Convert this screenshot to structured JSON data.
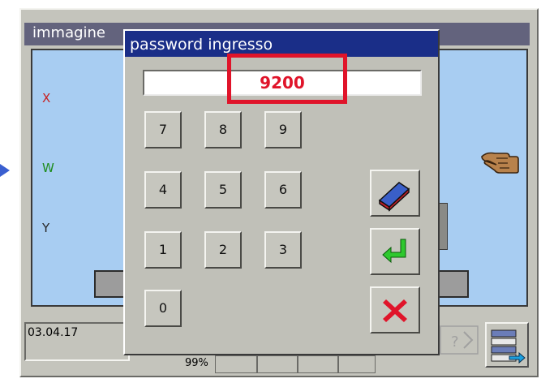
{
  "background_window": {
    "title": "immagine",
    "axis_labels": {
      "x": "X",
      "w": "W",
      "y": "Y"
    },
    "date": "03.04.17",
    "percent": "99%"
  },
  "dialog": {
    "title": "password ingresso",
    "password_value": "9200",
    "keypad": {
      "k7": "7",
      "k8": "8",
      "k9": "9",
      "k4": "4",
      "k5": "5",
      "k6": "6",
      "k1": "1",
      "k2": "2",
      "k3": "3",
      "k0": "0"
    },
    "function_keys": {
      "clear": "eraser-icon",
      "enter": "enter-arrow-icon",
      "cancel": "cancel-x-icon"
    }
  },
  "colors": {
    "dialog_titlebar": "#1a2e88",
    "password_text": "#e0142a",
    "highlight_frame": "#e0142a",
    "screen_background": "#a8cdf2"
  }
}
